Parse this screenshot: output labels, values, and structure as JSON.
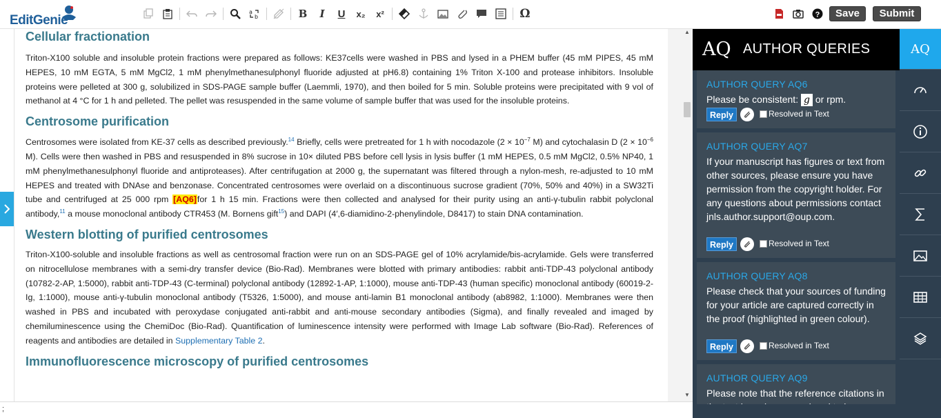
{
  "app": {
    "logo_text": "EditGenie"
  },
  "toolbar": {
    "save_label": "Save",
    "submit_label": "Submit",
    "bold": "B",
    "italic": "I",
    "underline": "U",
    "subscript": "x₂",
    "superscript": "x²",
    "omega": "Ω"
  },
  "document": {
    "sections": [
      {
        "title": "Cellular fractionation",
        "para": "Triton-X100 soluble and insoluble protein fractions were prepared as follows: KE37cells were washed in PBS and lysed in a PHEM buffer (45 mM PIPES, 45 mM HEPES, 10 mM EGTA, 5 mM MgCl2, 1 mM phenylmethanesulphonyl fluoride adjusted at pH6.8) containing 1% Triton X-100 and protease inhibitors. Insoluble proteins were pelleted at 300 g, solubilized in SDS-PAGE sample buffer (Laemmli, 1970), and then boiled for 5 min. Soluble proteins were precipitated with 9 vol of methanol at 4 °C for 1 h and pelleted. The pellet was resuspended in the same volume of sample buffer that was used for the insoluble proteins."
      },
      {
        "title": "Centrosome purification",
        "p1": "Centrosomes were isolated from KE-37 cells as described previously.",
        "ref14": "14",
        "p2": " Briefly, cells were pretreated for 1 h with nocodazole (2 × 10",
        "exp1": "−7",
        "p3": " M) and cytochalasin D (2 × 10",
        "exp2": "−6",
        "p4": " M). Cells were then washed in PBS and resuspended in 8% sucrose in 10× diluted PBS before cell lysis in lysis buffer (1 mM HEPES, 0.5 mM MgCl2, 0.5% NP40, 1 mM phenylmethanesulphonyl fluoride and antiproteases). After centrifugation at 2000 g, the supernatant was filtered through a nylon-mesh, re-adjusted to 10 mM HEPES and treated with DNAse and benzonase. Concentrated centrosomes were overlaid on a discontinuous sucrose gradient (70%, 50% and 40%) in a SW32Ti tube and centrifuged at 25 000 rpm ",
        "aq_mark": "[AQ6]",
        "p5": "for 1 h 15 min. Fractions were then collected and analysed for their purity using an anti-γ-tubulin rabbit polyclonal antibody,",
        "ref11": "11",
        "p6": " a mouse monoclonal antibody CTR453 (M. Bornens gift",
        "ref15": "15",
        "p7": ") and DAPI (4′,6-diamidino-2-phenylindole, D8417) to stain DNA contamination."
      },
      {
        "title": "Western blotting of purified centrosomes",
        "p1": "Triton-X100-soluble and insoluble fractions as well as centrosomal fraction were run on an SDS-PAGE gel of 10% acrylamide/bis-acrylamide. Gels were transferred on nitrocellulose membranes with a semi-dry transfer device (Bio-Rad). Membranes were blotted with primary antibodies: rabbit anti-TDP-43 polyclonal antibody (10782-2-AP, 1:5000), rabbit anti-TDP-43 (C-terminal) polyclonal antibody (12892-1-AP, 1:1000), mouse anti-TDP-43 (human specific) monoclonal antibody (60019-2-Ig, 1:1000), mouse anti-γ-tubulin monoclonal antibody (T5326, 1:5000), and mouse anti-lamin B1 monoclonal antibody (ab8982, 1:1000). Membranes were then washed in PBS and incubated with peroxydase conjugated anti-rabbit and anti-mouse secondary antibodies (Sigma), and finally revealed and imaged by chemiluminescence using the ChemiDoc (Bio-Rad). Quantification of luminescence intensity were performed with Image Lab software (Bio-Rad). References of reagents and antibodies are detailed in ",
        "link": "Supplementary Table 2",
        "p2": "."
      },
      {
        "title": "Immunofluorescence microscopy of purified centrosomes"
      }
    ]
  },
  "status_bar": {
    "text": ";"
  },
  "aq_panel": {
    "logo": "AQ",
    "title": "AUTHOR QUERIES",
    "reply_label": "Reply",
    "resolved_label": "Resolved in Text",
    "queries": [
      {
        "title": "AUTHOR QUERY  AQ6",
        "text_a": "Please be consistent: ",
        "g": "g",
        "text_b": " or rpm."
      },
      {
        "title": "AUTHOR QUERY  AQ7",
        "text": "If your manuscript has figures or text from other sources, please ensure you have permission from the copyright holder. For any questions about permissions contact jnls.author.support@oup.com."
      },
      {
        "title": "AUTHOR QUERY  AQ8",
        "text": "Please check that your sources of funding for your article are captured correctly in the proof (highlighted in green colour)."
      },
      {
        "title": "AUTHOR QUERY  AQ9",
        "text": "Please note that the reference citations in the text have been reordered to be"
      }
    ]
  },
  "side_bar": {
    "aq_label": "AQ"
  },
  "colors": {
    "accent": "#1fa8ec",
    "panel": "#2e3f4f",
    "heading": "#3a7a8c",
    "query_title": "#2aa8e8",
    "reply": "#1f78c4"
  }
}
